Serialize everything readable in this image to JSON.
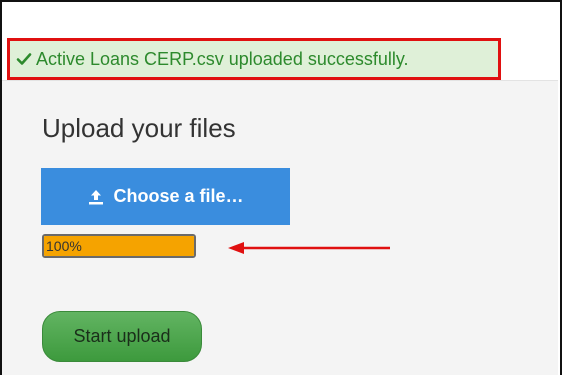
{
  "notification": {
    "message": "Active Loans CERP.csv uploaded successfully.",
    "icon": "check-icon",
    "color": "#2d8a2d",
    "background": "#dff0d8",
    "highlight_border": "#e01010"
  },
  "upload": {
    "title": "Upload your files",
    "choose_label": "Choose a file…",
    "choose_icon": "upload-icon",
    "progress": {
      "value_percent": 100,
      "label": "100%",
      "fill_color": "#f5a300"
    },
    "annotation_arrow_color": "#e01010",
    "start_label": "Start upload"
  },
  "colors": {
    "choose_button": "#3a8dde",
    "start_button": "#4caf50",
    "content_background": "#f4f4f4"
  }
}
